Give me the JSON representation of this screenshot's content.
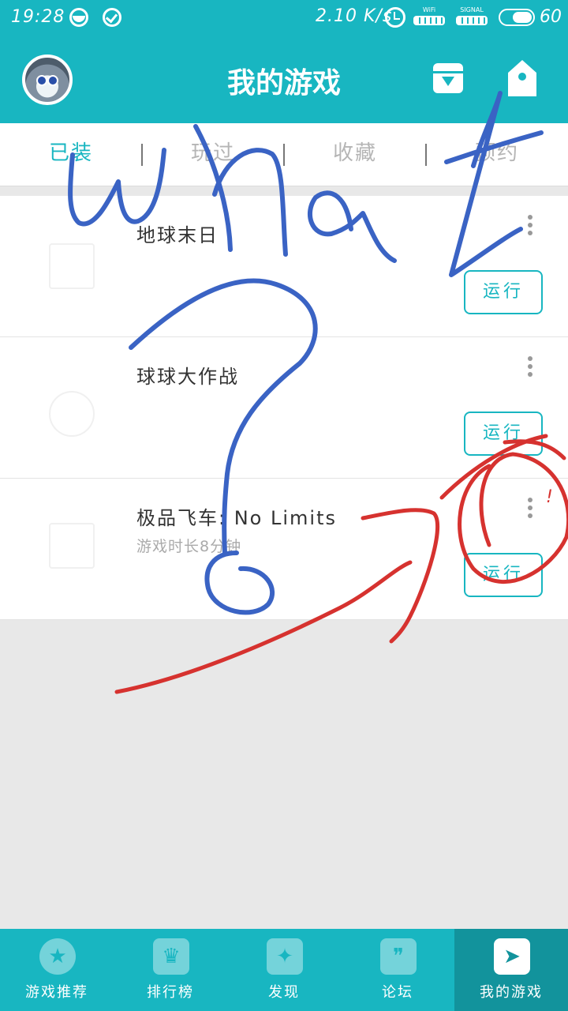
{
  "status_bar": {
    "time": "19:28",
    "speed": "2.10 K/s",
    "wifi_label": "WiFi",
    "signal_label": "SIGNAL",
    "battery": "60"
  },
  "header": {
    "title": "我的游戏"
  },
  "tabs": [
    {
      "label": "已装",
      "active": true
    },
    {
      "label": "玩过",
      "active": false
    },
    {
      "label": "收藏",
      "active": false
    },
    {
      "label": "预约",
      "active": false
    }
  ],
  "games": [
    {
      "name": "地球末日",
      "subtitle": "",
      "action": "运行"
    },
    {
      "name": "球球大作战",
      "subtitle": "",
      "action": "运行"
    },
    {
      "name": "极品飞车: No Limits",
      "subtitle": "游戏时长8分钟",
      "action": "运行"
    }
  ],
  "bottom_nav": [
    {
      "label": "游戏推荐",
      "icon": "star-icon"
    },
    {
      "label": "排行榜",
      "icon": "trophy-icon"
    },
    {
      "label": "发现",
      "icon": "sparkle-icon"
    },
    {
      "label": "论坛",
      "icon": "quote-icon"
    },
    {
      "label": "我的游戏",
      "icon": "send-icon",
      "active": true
    }
  ],
  "annotations": {
    "handwriting": "what",
    "mark": "!"
  },
  "colors": {
    "accent": "#18b6c1",
    "accent_dark": "#12939c",
    "ink_blue": "#3a63c4",
    "ink_red": "#d6322f"
  }
}
